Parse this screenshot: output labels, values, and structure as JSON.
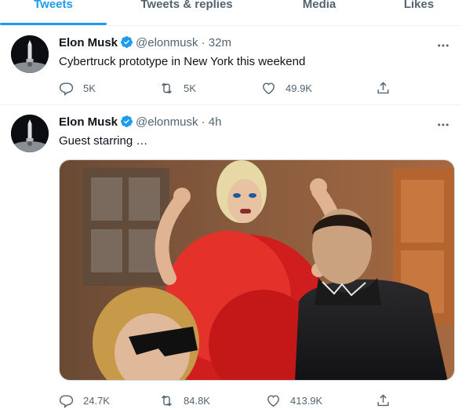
{
  "tabs": [
    {
      "label": "Tweets",
      "active": true
    },
    {
      "label": "Tweets & replies",
      "active": false
    },
    {
      "label": "Media",
      "active": false
    },
    {
      "label": "Likes",
      "active": false
    }
  ],
  "tweets": [
    {
      "name": "Elon Musk",
      "handle": "@elonmusk",
      "dot": "·",
      "time": "32m",
      "text": "Cybertruck prototype in New York this weekend",
      "replies": "5K",
      "retweets": "5K",
      "likes": "49.9K",
      "has_media": false
    },
    {
      "name": "Elon Musk",
      "handle": "@elonmusk",
      "dot": "·",
      "time": "4h",
      "text": "Guest starring …",
      "replies": "24.7K",
      "retweets": "84.8K",
      "likes": "413.9K",
      "has_media": true
    }
  ],
  "colors": {
    "accent": "#1d9bf0",
    "secondary_text": "#536471",
    "primary_text": "#0f1419"
  },
  "icons": [
    "verified-badge-icon",
    "more-icon",
    "reply-icon",
    "retweet-icon",
    "like-icon",
    "share-icon"
  ]
}
